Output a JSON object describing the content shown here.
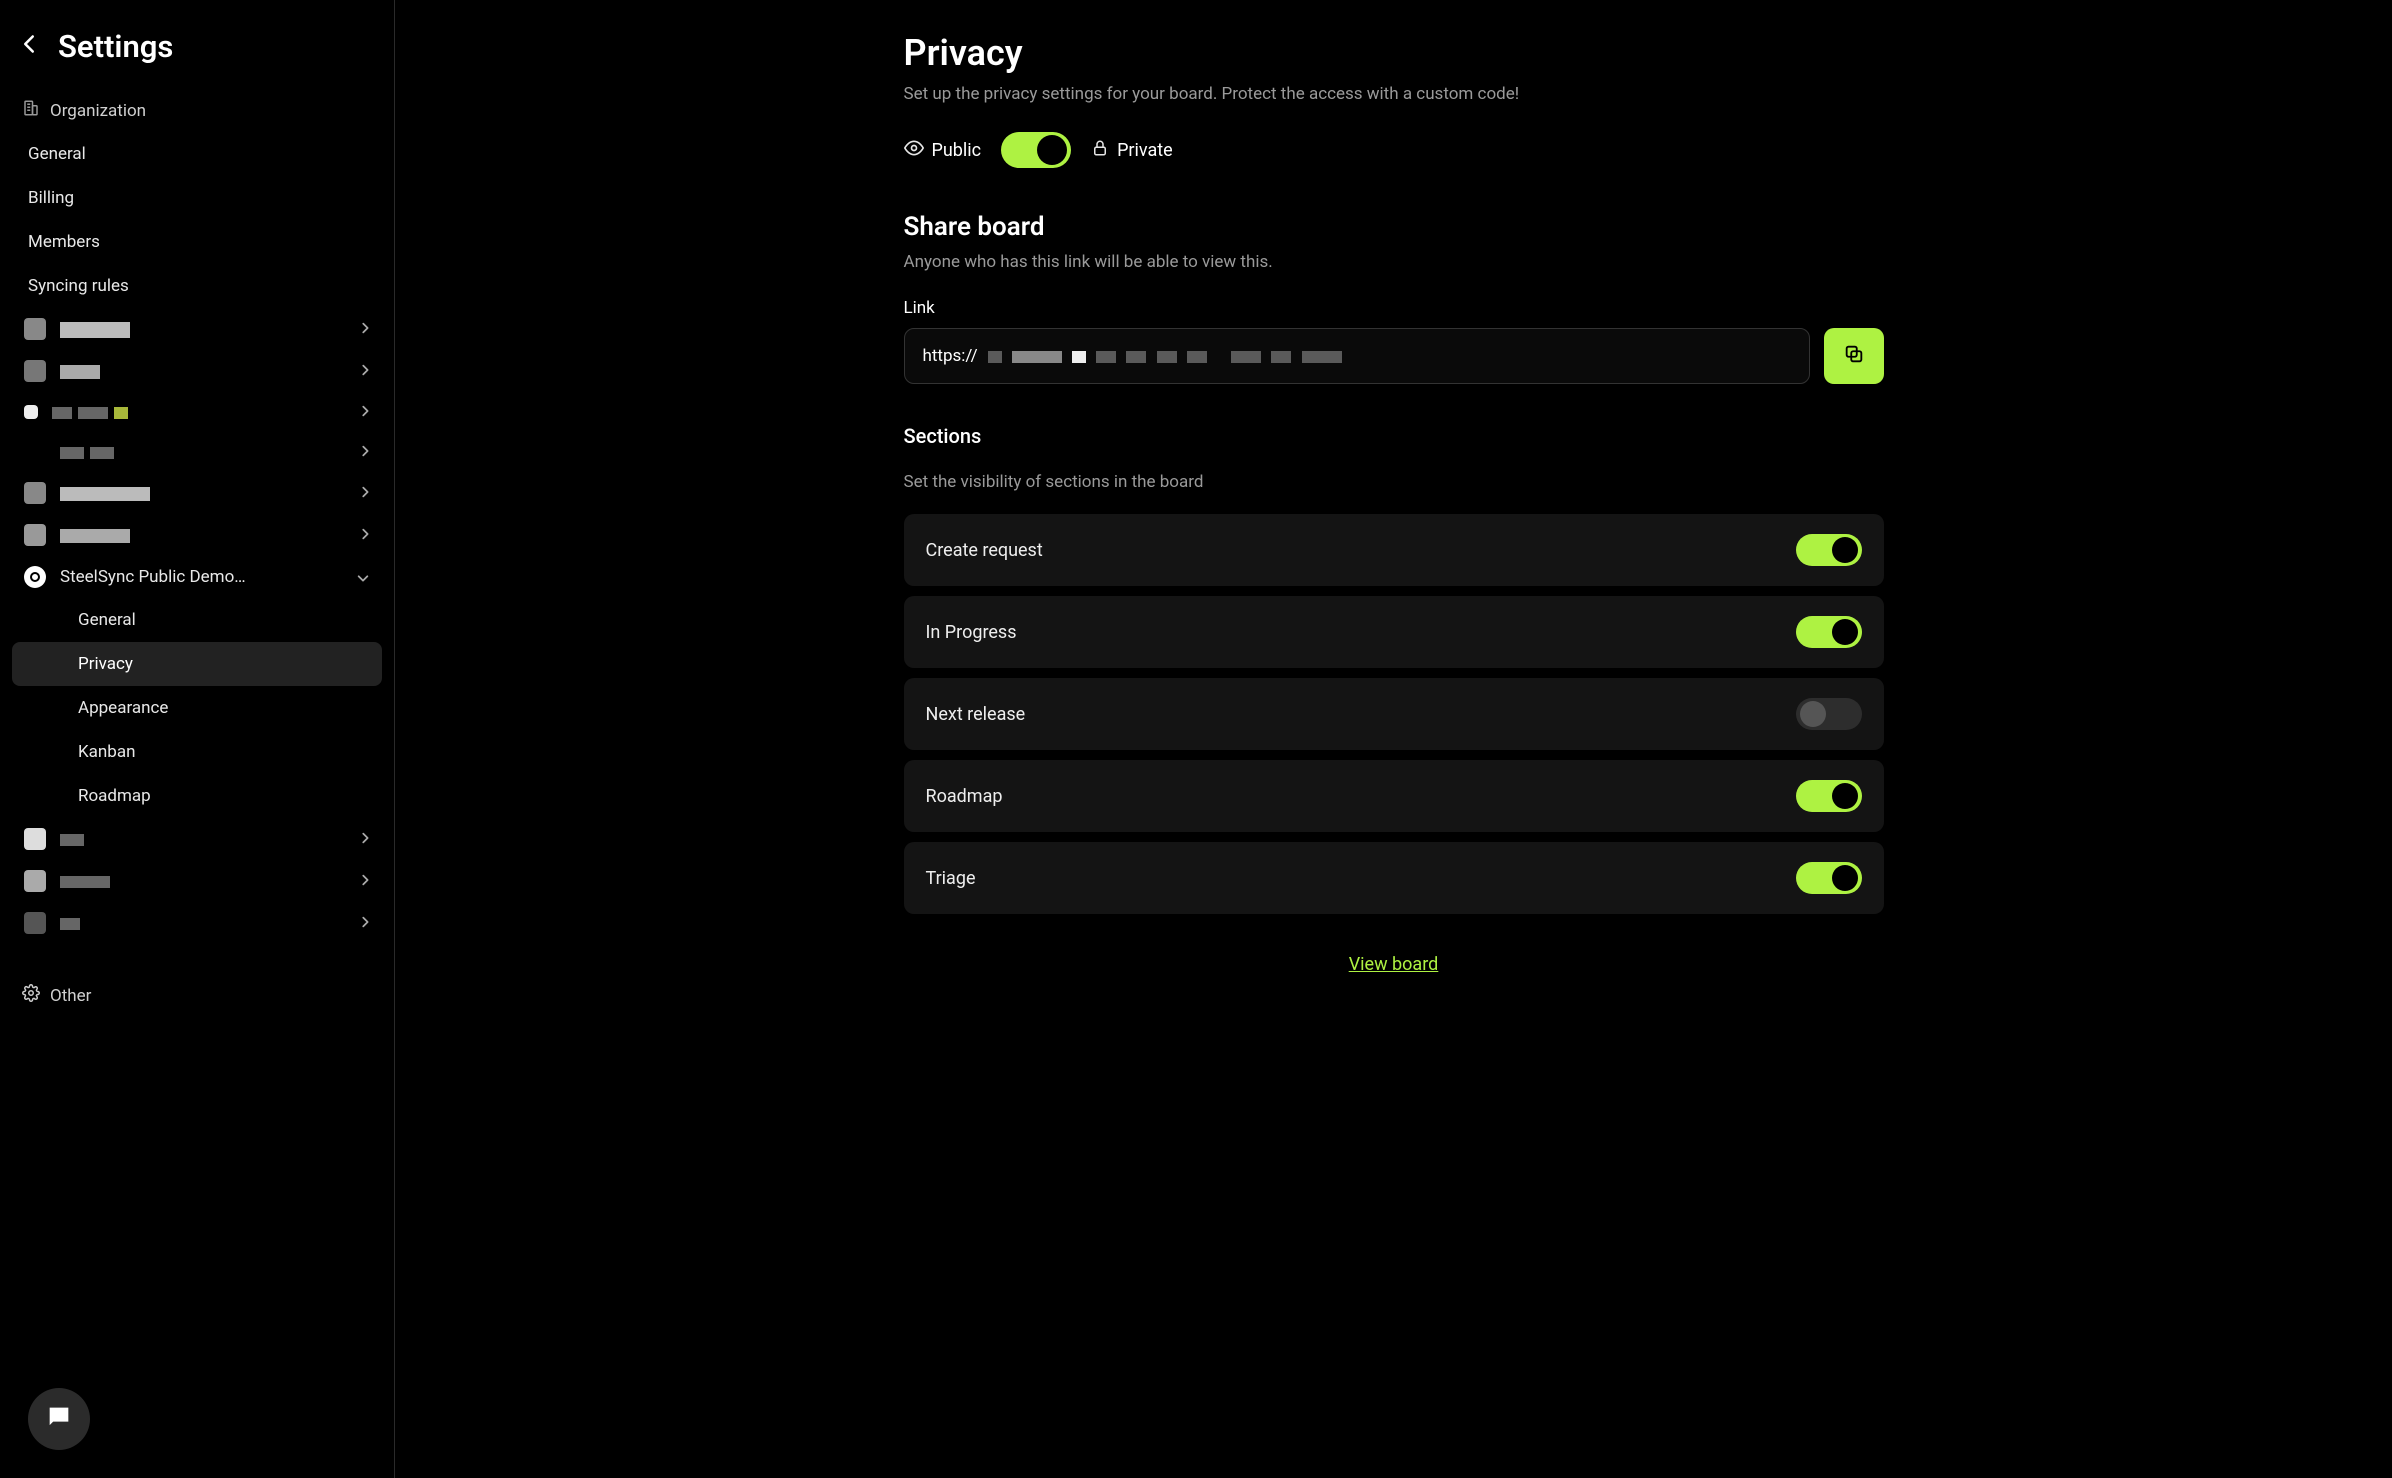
{
  "sidebar": {
    "title": "Settings",
    "organization_label": "Organization",
    "org_items": [
      "General",
      "Billing",
      "Members",
      "Syncing rules"
    ],
    "projects": [
      {
        "redacted": true
      },
      {
        "redacted": true
      },
      {
        "redacted": true
      },
      {
        "redacted": true
      },
      {
        "redacted": true
      },
      {
        "redacted": true
      }
    ],
    "expanded_project": {
      "name": "SteelSync Public Demo…",
      "items": [
        "General",
        "Privacy",
        "Appearance",
        "Kanban",
        "Roadmap"
      ],
      "active": "Privacy"
    },
    "bottom_projects": [
      {
        "redacted": true
      },
      {
        "redacted": true
      },
      {
        "redacted": true
      }
    ],
    "other_label": "Other"
  },
  "main": {
    "title": "Privacy",
    "description": "Set up the privacy settings for your board. Protect the access with a custom code!",
    "public_label": "Public",
    "private_label": "Private",
    "privacy_state": "public",
    "share": {
      "title": "Share board",
      "subtitle": "Anyone who has this link will be able to view this.",
      "link_label": "Link",
      "link_prefix": "https://"
    },
    "sections": {
      "title": "Sections",
      "subtitle": "Set the visibility of sections in the board",
      "items": [
        {
          "label": "Create request",
          "enabled": true
        },
        {
          "label": "In Progress",
          "enabled": true
        },
        {
          "label": "Next release",
          "enabled": false
        },
        {
          "label": "Roadmap",
          "enabled": true
        },
        {
          "label": "Triage",
          "enabled": true
        }
      ]
    },
    "view_board_label": "View board"
  },
  "colors": {
    "accent": "#aef242"
  }
}
